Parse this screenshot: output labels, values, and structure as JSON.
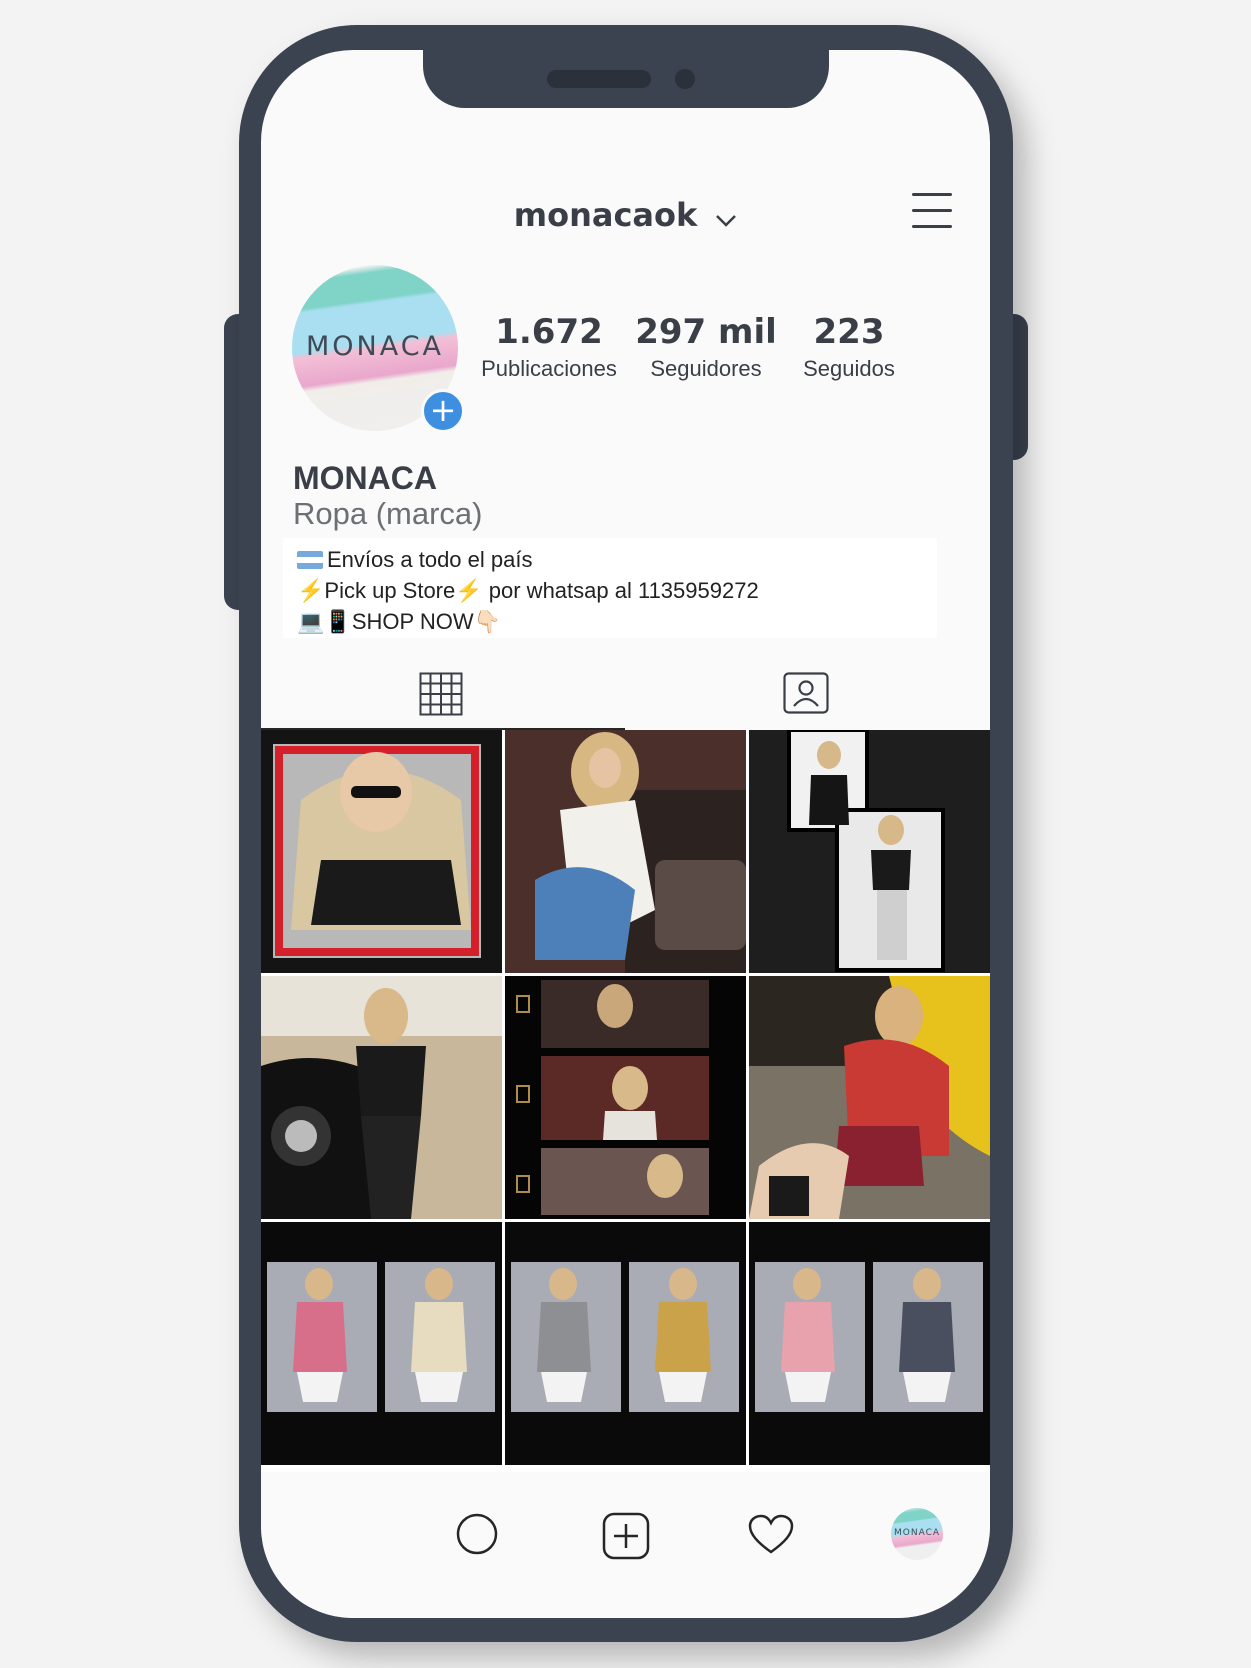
{
  "header": {
    "username": "monacaok"
  },
  "profile": {
    "avatar_logo_text": "MONACA",
    "name": "MONACA",
    "category": "Ropa (marca)",
    "stats": [
      {
        "value": "1.672",
        "label": "Publicaciones"
      },
      {
        "value": "297 mil",
        "label": "Seguidores"
      },
      {
        "value": "223",
        "label": "Seguidos"
      }
    ],
    "bio": [
      {
        "text": "Envíos a todo el país"
      },
      {
        "text": "Pick up Store",
        "text2": " por whatsap al 1135959272"
      },
      {
        "text": "SHOP NOW"
      }
    ],
    "bio_emoji": {
      "monitor": "💻",
      "phone": "📱",
      "hand": "👇🏻",
      "bolt": "⚡"
    }
  },
  "nav": {
    "avatar_text": "MONACA"
  },
  "icons": {
    "menu": "hamburger-icon",
    "chevron": "chevron-down-icon",
    "grid": "grid-icon",
    "tagged": "tagged-user-icon",
    "home": "home-icon",
    "add": "add-post-icon",
    "heart": "heart-icon"
  },
  "colors": {
    "phone": "#3b4350",
    "accent": "#3f8fe0",
    "text": "#3a3f47"
  }
}
